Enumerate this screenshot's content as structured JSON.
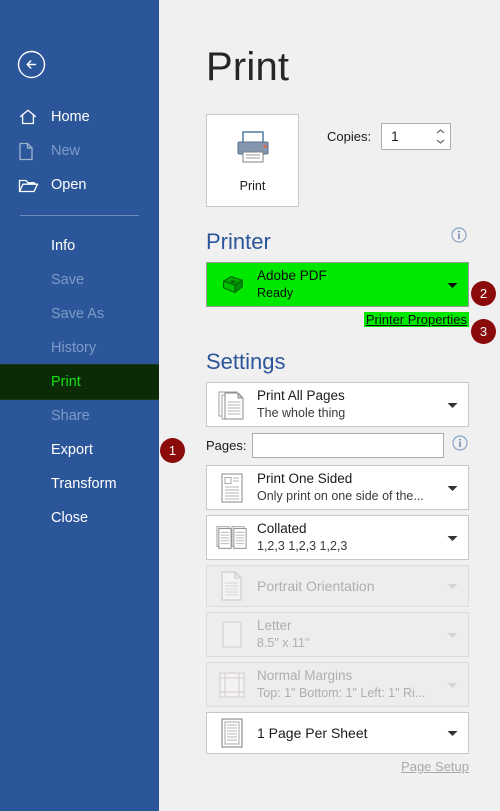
{
  "sidebar": {
    "back_icon": "back-arrow-icon",
    "items": [
      {
        "label": "Home",
        "icon": "home-icon",
        "state": "enabled",
        "indent": false
      },
      {
        "label": "New",
        "icon": "page-icon",
        "state": "disabled",
        "indent": false
      },
      {
        "label": "Open",
        "icon": "folder-icon",
        "state": "enabled",
        "indent": false
      },
      {
        "label": "Info",
        "icon": "none",
        "state": "enabled",
        "indent": true
      },
      {
        "label": "Save",
        "icon": "none",
        "state": "disabled",
        "indent": true
      },
      {
        "label": "Save As",
        "icon": "none",
        "state": "disabled",
        "indent": true
      },
      {
        "label": "History",
        "icon": "none",
        "state": "disabled",
        "indent": true
      },
      {
        "label": "Print",
        "icon": "none",
        "state": "active",
        "indent": true
      },
      {
        "label": "Share",
        "icon": "none",
        "state": "disabled",
        "indent": true
      },
      {
        "label": "Export",
        "icon": "none",
        "state": "enabled",
        "indent": true
      },
      {
        "label": "Transform",
        "icon": "none",
        "state": "enabled",
        "indent": true
      },
      {
        "label": "Close",
        "icon": "none",
        "state": "enabled",
        "indent": true
      }
    ]
  },
  "main": {
    "title": "Print",
    "print_button": {
      "label": "Print",
      "icon": "printer-icon"
    },
    "copies": {
      "label": "Copies:",
      "value": "1",
      "spinner_icon": "spinner-arrows-icon"
    }
  },
  "printer_section": {
    "heading": "Printer",
    "info_icon": "info-icon",
    "selected": {
      "name": "Adobe PDF",
      "status": "Ready",
      "icon": "printer-icon"
    },
    "properties_link": "Printer Properties"
  },
  "settings_section": {
    "heading": "Settings",
    "rows": [
      {
        "main": "Print All Pages",
        "sub": "The whole thing",
        "icon": "stacked-pages-icon",
        "state": "enabled"
      },
      {
        "main": "Print One Sided",
        "sub": "Only print on one side of the...",
        "icon": "one-sided-page-icon",
        "state": "enabled"
      },
      {
        "main": "Collated",
        "sub": "1,2,3    1,2,3    1,2,3",
        "icon": "collated-pages-icon",
        "state": "enabled"
      },
      {
        "main": "Portrait Orientation",
        "sub": "",
        "icon": "portrait-page-icon",
        "state": "disabled"
      },
      {
        "main": "Letter",
        "sub": "8.5\" x 11\"",
        "icon": "paper-size-icon",
        "state": "disabled"
      },
      {
        "main": "Normal Margins",
        "sub": "Top: 1\" Bottom: 1\" Left: 1\" Ri...",
        "icon": "margins-icon",
        "state": "disabled"
      },
      {
        "main": "1 Page Per Sheet",
        "sub": "",
        "icon": "page-per-sheet-icon",
        "state": "enabled"
      }
    ],
    "pages": {
      "label": "Pages:",
      "value": "",
      "placeholder": "",
      "info_icon": "info-icon"
    },
    "page_setup_link": "Page Setup"
  },
  "callouts": [
    {
      "number": "1",
      "target": "sidebar-item-print"
    },
    {
      "number": "2",
      "target": "printer-select"
    },
    {
      "number": "3",
      "target": "printer-properties-link"
    }
  ],
  "colors": {
    "sidebar_blue": "#2B579A",
    "highlight_green": "#00E800",
    "active_item_bg": "#0B2B08",
    "active_item_text": "#18E018",
    "badge_red": "#8B0A0A",
    "heading_blue": "#2B579A"
  }
}
